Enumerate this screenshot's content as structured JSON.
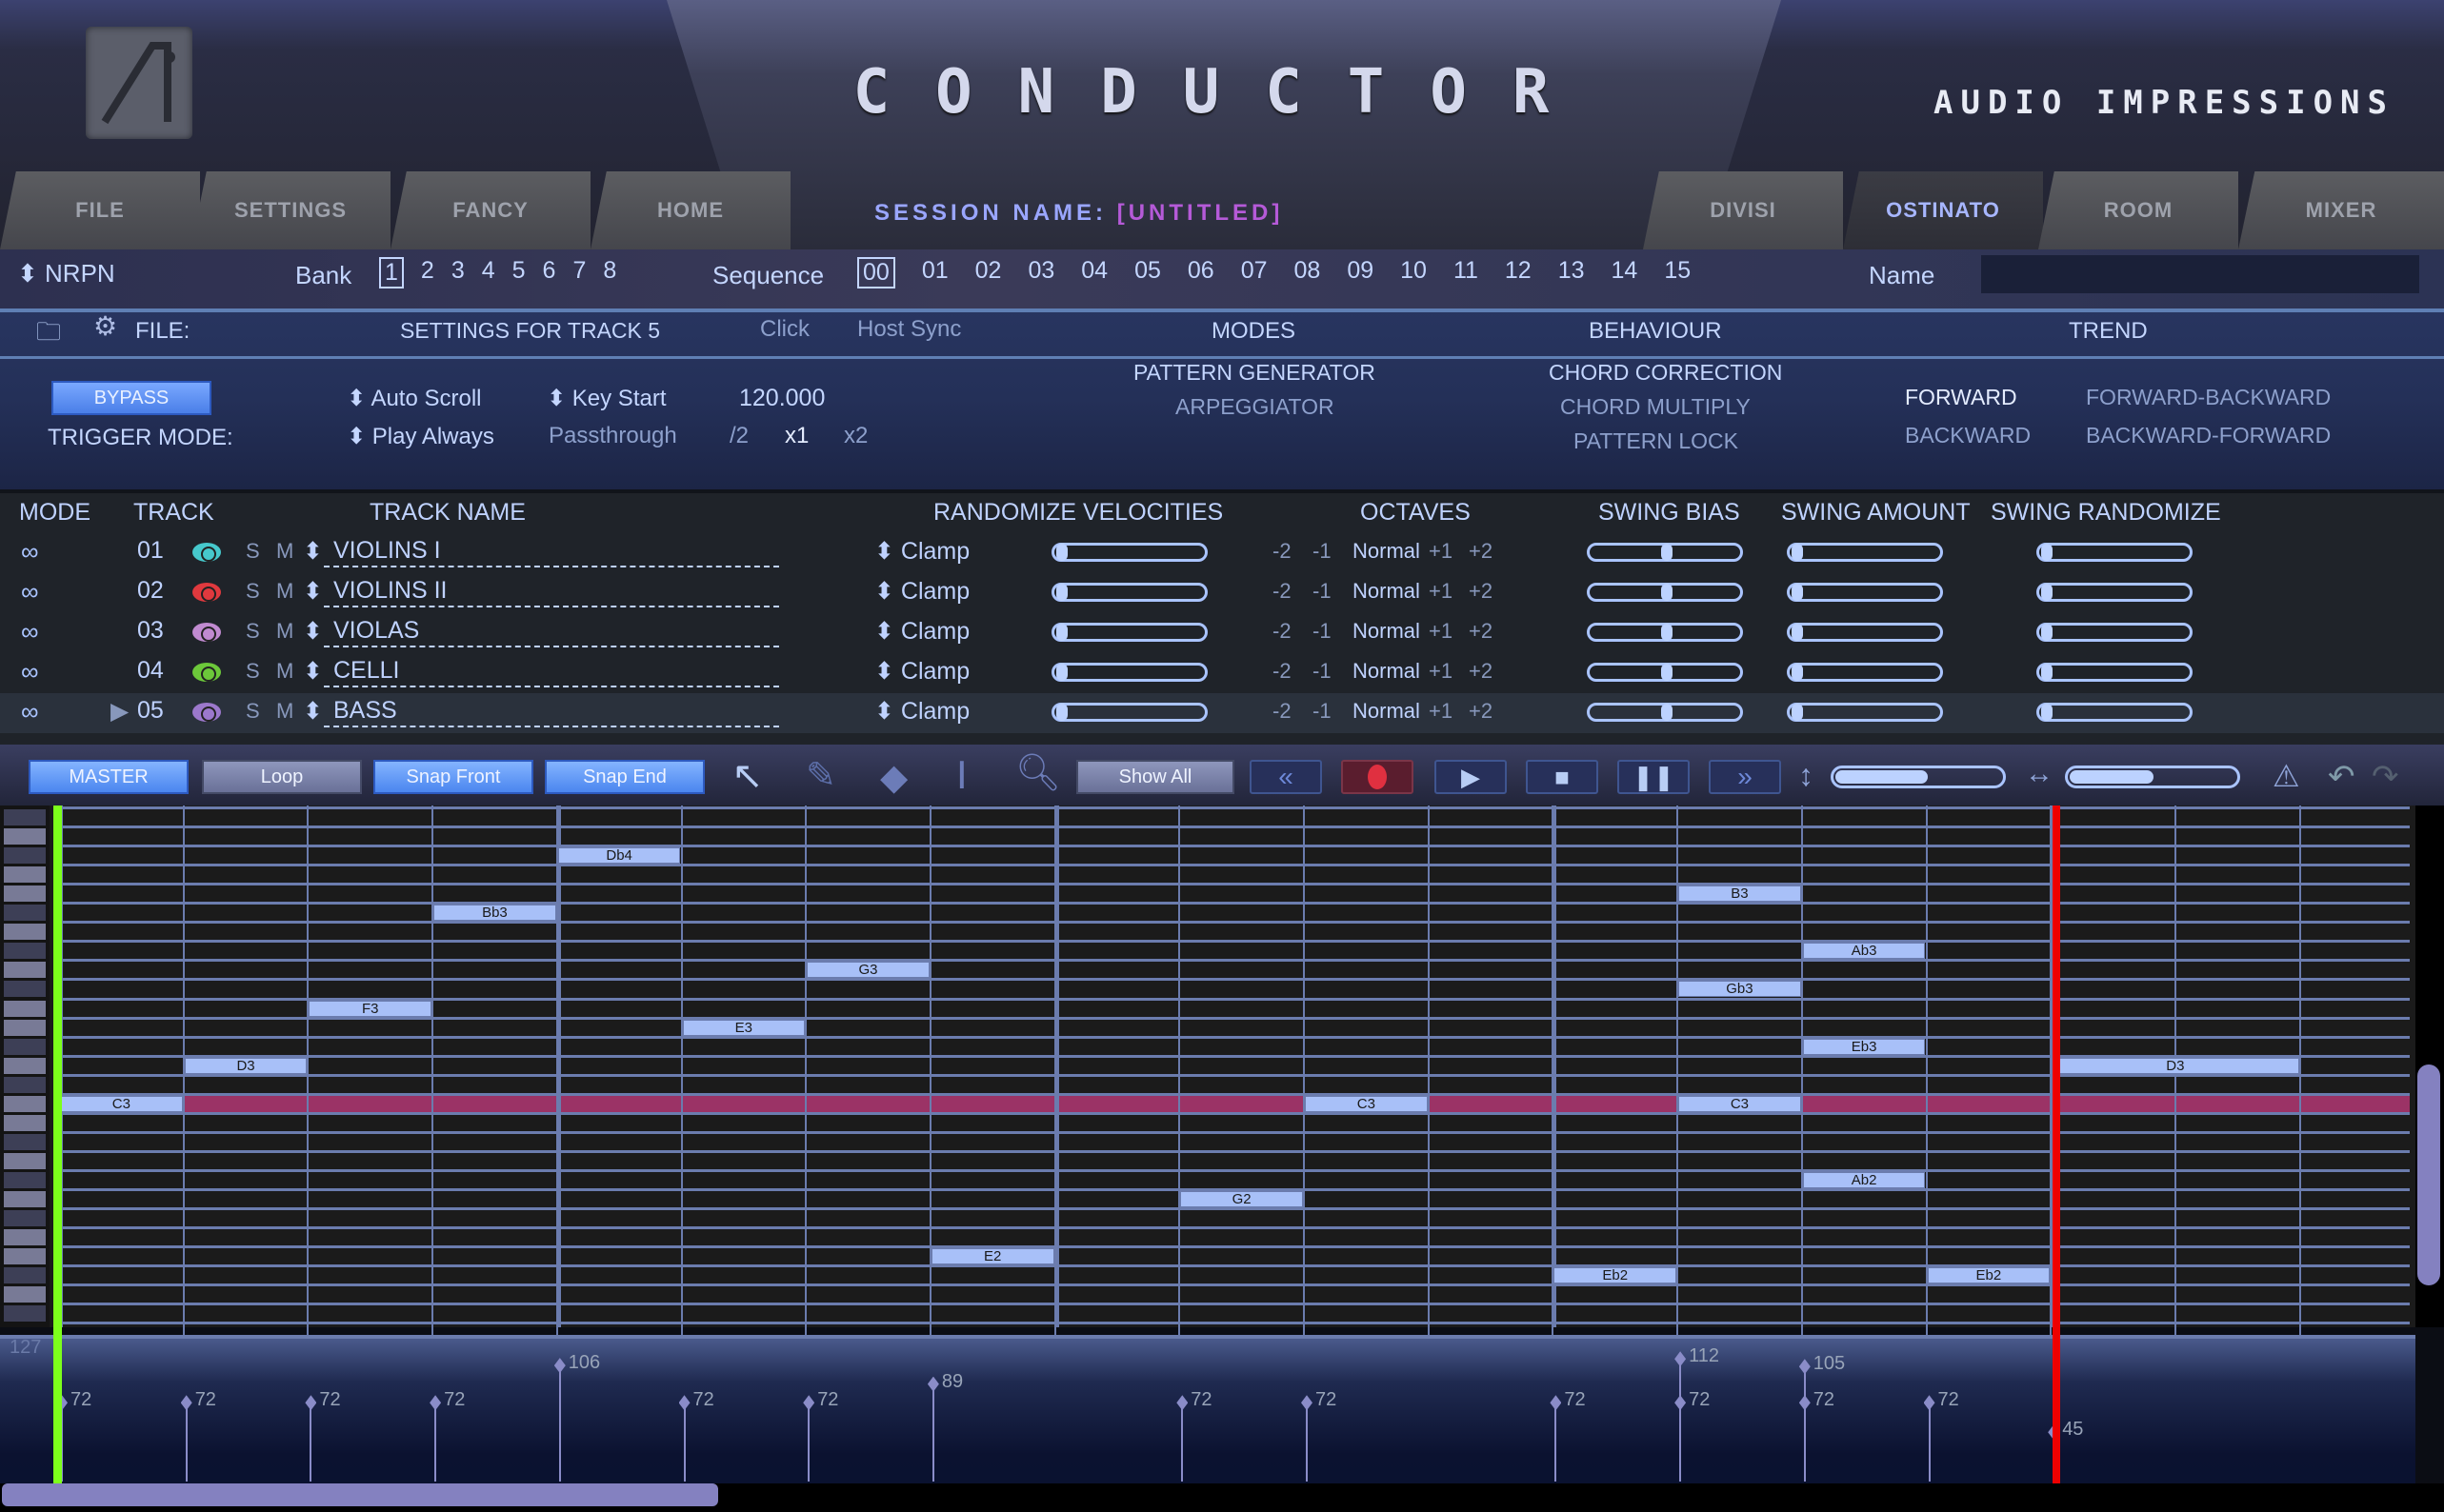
{
  "header": {
    "title": "CONDUCTOR",
    "brand": "AUDIO IMPRESSIONS",
    "session_label": "SESSION NAME:",
    "session_value": "[UNTITLED]",
    "tabs_left": [
      "FILE",
      "SETTINGS",
      "FANCY",
      "HOME"
    ],
    "tabs_right": [
      "DIVISI",
      "OSTINATO",
      "ROOM",
      "MIXER"
    ],
    "active_tab": "OSTINATO"
  },
  "nrpn_row": {
    "nrpn_label": "NRPN",
    "bank_label": "Bank",
    "banks": [
      "1",
      "2",
      "3",
      "4",
      "5",
      "6",
      "7",
      "8"
    ],
    "selected_bank": "1",
    "sequence_label": "Sequence",
    "sequences": [
      "00",
      "01",
      "02",
      "03",
      "04",
      "05",
      "06",
      "07",
      "08",
      "09",
      "10",
      "11",
      "12",
      "13",
      "14",
      "15"
    ],
    "selected_sequence": "00",
    "name_label": "Name",
    "name_value": ""
  },
  "settings": {
    "file_label": "FILE:",
    "file_value": "SETTINGS FOR TRACK 5",
    "click_label": "Click",
    "host_sync_label": "Host Sync",
    "modes_header": "MODES",
    "behaviour_header": "BEHAVIOUR",
    "trend_header": "TREND",
    "bypass_label": "BYPASS",
    "trigger_mode_label": "TRIGGER MODE:",
    "auto_scroll_label": "Auto Scroll",
    "key_start_label": "Key Start",
    "tempo_value": "120.000",
    "play_always_label": "Play Always",
    "passthrough_label": "Passthrough",
    "rate_options": [
      "/2",
      "x1",
      "x2"
    ],
    "selected_rate": "x1",
    "modes": [
      "PATTERN GENERATOR",
      "ARPEGGIATOR"
    ],
    "selected_mode": "PATTERN GENERATOR",
    "behaviours": [
      "CHORD CORRECTION",
      "CHORD MULTIPLY",
      "PATTERN LOCK"
    ],
    "selected_behaviour": "CHORD CORRECTION",
    "trends": [
      "FORWARD",
      "FORWARD-BACKWARD",
      "BACKWARD",
      "BACKWARD-FORWARD"
    ],
    "selected_trend": "FORWARD"
  },
  "tracks": {
    "headers": [
      "MODE",
      "TRACK",
      "TRACK NAME",
      "RANDOMIZE VELOCITIES",
      "OCTAVES",
      "SWING BIAS",
      "SWING AMOUNT",
      "SWING RANDOMIZE"
    ],
    "solo_label": "S",
    "mute_label": "M",
    "octave_options": [
      "-2",
      "-1",
      "Normal",
      "+1",
      "+2"
    ],
    "rows": [
      {
        "num": "01",
        "name": "VIOLINS I",
        "eye_color": "#46c8cc",
        "clamp": "Clamp",
        "octave": "Normal",
        "rand_vel": 0,
        "swing_bias": 0.5,
        "swing_amount": 0,
        "swing_randomize": 0,
        "selected": false
      },
      {
        "num": "02",
        "name": "VIOLINS II",
        "eye_color": "#e0393e",
        "clamp": "Clamp",
        "octave": "Normal",
        "rand_vel": 0,
        "swing_bias": 0.5,
        "swing_amount": 0,
        "swing_randomize": 0,
        "selected": false
      },
      {
        "num": "03",
        "name": "VIOLAS",
        "eye_color": "#c08ad0",
        "clamp": "Clamp",
        "octave": "Normal",
        "rand_vel": 0,
        "swing_bias": 0.5,
        "swing_amount": 0,
        "swing_randomize": 0,
        "selected": false
      },
      {
        "num": "04",
        "name": "CELLI",
        "eye_color": "#6cc83a",
        "clamp": "Clamp",
        "octave": "Normal",
        "rand_vel": 0,
        "swing_bias": 0.5,
        "swing_amount": 0,
        "swing_randomize": 0,
        "selected": false
      },
      {
        "num": "05",
        "name": "BASS",
        "eye_color": "#9c78cc",
        "clamp": "Clamp",
        "octave": "Normal",
        "rand_vel": 0,
        "swing_bias": 0.5,
        "swing_amount": 0,
        "swing_randomize": 0,
        "selected": true
      }
    ]
  },
  "toolbar": {
    "master_label": "MASTER",
    "loop_label": "Loop",
    "snap_front_label": "Snap Front",
    "snap_end_label": "Snap End",
    "show_all_label": "Show All",
    "vertical_zoom": 0.55,
    "horizontal_zoom": 0.5
  },
  "piano_roll": {
    "highlight_note": "C3",
    "notes": [
      {
        "label": "C3",
        "step": 0,
        "row": 15
      },
      {
        "label": "D3",
        "step": 1,
        "row": 13
      },
      {
        "label": "F3",
        "step": 2,
        "row": 10
      },
      {
        "label": "Bb3",
        "step": 3,
        "row": 5
      },
      {
        "label": "Db4",
        "step": 4,
        "row": 2
      },
      {
        "label": "E3",
        "step": 5,
        "row": 11
      },
      {
        "label": "G3",
        "step": 6,
        "row": 8
      },
      {
        "label": "E2",
        "step": 7,
        "row": 23
      },
      {
        "label": "G2",
        "step": 9,
        "row": 20
      },
      {
        "label": "C3",
        "step": 10,
        "row": 15
      },
      {
        "label": "Eb2",
        "step": 12,
        "row": 24
      },
      {
        "label": "B3",
        "step": 13,
        "row": 4
      },
      {
        "label": "Gb3",
        "step": 13,
        "row": 9
      },
      {
        "label": "C3",
        "step": 13,
        "row": 15
      },
      {
        "label": "Ab3",
        "step": 14,
        "row": 7
      },
      {
        "label": "Eb3",
        "step": 14,
        "row": 12
      },
      {
        "label": "Ab2",
        "step": 14,
        "row": 19
      },
      {
        "label": "Eb2",
        "step": 15,
        "row": 24
      },
      {
        "label": "D3",
        "step": 16,
        "row": 13,
        "len": 2
      }
    ]
  },
  "velocity_lane": {
    "max_label": "127",
    "events": [
      {
        "step": 0,
        "values": [
          72
        ]
      },
      {
        "step": 1,
        "values": [
          72
        ]
      },
      {
        "step": 2,
        "values": [
          72
        ]
      },
      {
        "step": 3,
        "values": [
          72
        ]
      },
      {
        "step": 4,
        "values": [
          106
        ]
      },
      {
        "step": 5,
        "values": [
          72
        ]
      },
      {
        "step": 6,
        "values": [
          72
        ]
      },
      {
        "step": 7,
        "values": [
          89
        ]
      },
      {
        "step": 9,
        "values": [
          72
        ]
      },
      {
        "step": 10,
        "values": [
          72
        ]
      },
      {
        "step": 12,
        "values": [
          72
        ]
      },
      {
        "step": 13,
        "values": [
          72,
          112
        ]
      },
      {
        "step": 14,
        "values": [
          72,
          105
        ]
      },
      {
        "step": 15,
        "values": [
          72
        ]
      },
      {
        "step": 16,
        "values": [
          45
        ]
      }
    ]
  }
}
